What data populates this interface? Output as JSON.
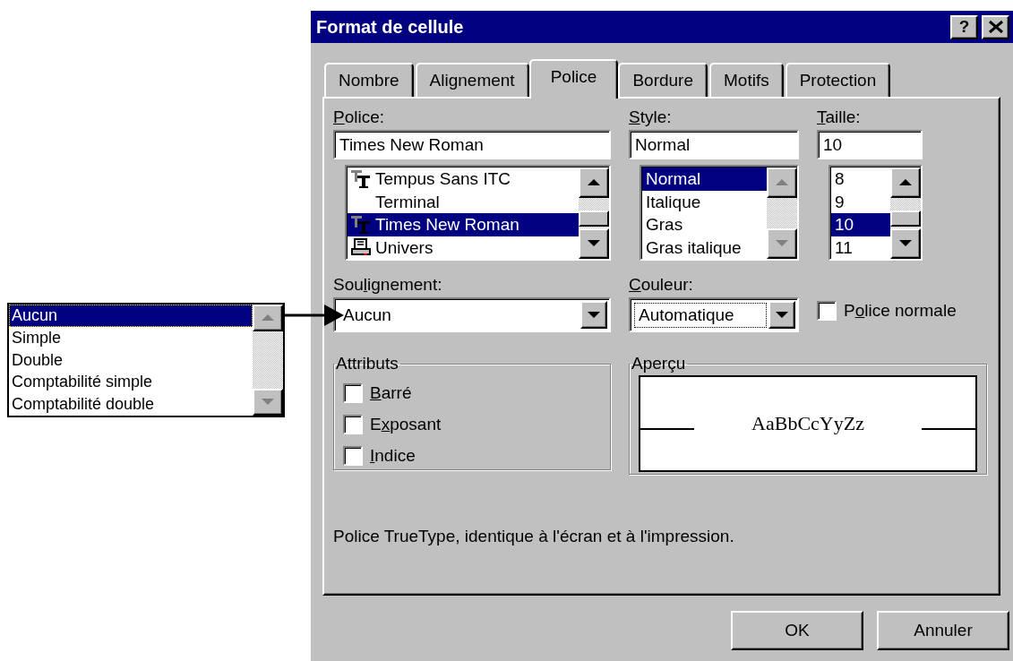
{
  "window": {
    "title": "Format de cellule",
    "help": "?"
  },
  "tabs": [
    {
      "label": "Nombre",
      "selected": false
    },
    {
      "label": "Alignement",
      "selected": false
    },
    {
      "label": "Police",
      "selected": true
    },
    {
      "label": "Bordure",
      "selected": false
    },
    {
      "label": "Motifs",
      "selected": false
    },
    {
      "label": "Protection",
      "selected": false
    }
  ],
  "font": {
    "label": {
      "key": "P",
      "post": "olice:"
    },
    "value": "Times New Roman",
    "scrollbar_disabled": false,
    "items": [
      {
        "label": "Tempus Sans ITC",
        "kind": "truetype",
        "selected": false
      },
      {
        "label": "Terminal",
        "kind": "plain",
        "selected": false
      },
      {
        "label": "Times New Roman",
        "kind": "truetype",
        "selected": true
      },
      {
        "label": "Univers",
        "kind": "printer",
        "selected": false
      }
    ]
  },
  "style": {
    "label": {
      "key": "S",
      "post": "tyle:"
    },
    "value": "Normal",
    "scrollbar_disabled": true,
    "items": [
      {
        "label": "Normal",
        "selected": true
      },
      {
        "label": "Italique",
        "selected": false
      },
      {
        "label": "Gras",
        "selected": false
      },
      {
        "label": "Gras italique",
        "selected": false
      }
    ]
  },
  "size": {
    "label": {
      "key": "T",
      "post": "aille:"
    },
    "value": "10",
    "scrollbar_disabled": false,
    "items": [
      {
        "label": "8",
        "selected": false
      },
      {
        "label": "9",
        "selected": false
      },
      {
        "label": "10",
        "selected": true
      },
      {
        "label": "11",
        "selected": false
      }
    ]
  },
  "underline": {
    "label": {
      "pre": "Sou",
      "key": "l",
      "post": "ignement:"
    },
    "value": "Aucun",
    "focused": false
  },
  "color": {
    "label": {
      "key": "C",
      "post": "ouleur:"
    },
    "value": "Automatique",
    "focused": true
  },
  "normal_font": {
    "label": {
      "pre": "P",
      "key": "o",
      "post": "lice normale"
    },
    "checked": false
  },
  "attributes": {
    "title": "Attributs",
    "items": [
      {
        "label": {
          "key": "B",
          "post": "arré"
        },
        "checked": false
      },
      {
        "label": {
          "pre": "E",
          "key": "x",
          "post": "posant"
        },
        "checked": false
      },
      {
        "label": {
          "key": "I",
          "post": "ndice"
        },
        "checked": false
      }
    ]
  },
  "preview": {
    "title": "Aperçu",
    "sample": "AaBbCcYyZz"
  },
  "description": "Police TrueType, identique à l'écran et à l'impression.",
  "buttons": [
    {
      "label": "OK"
    },
    {
      "label": "Annuler"
    }
  ],
  "callout": {
    "items": [
      {
        "label": "Aucun",
        "selected": true
      },
      {
        "label": "Simple",
        "selected": false
      },
      {
        "label": "Double",
        "selected": false
      },
      {
        "label": "Comptabilité simple",
        "selected": false
      },
      {
        "label": "Comptabilité double",
        "selected": false
      }
    ]
  }
}
